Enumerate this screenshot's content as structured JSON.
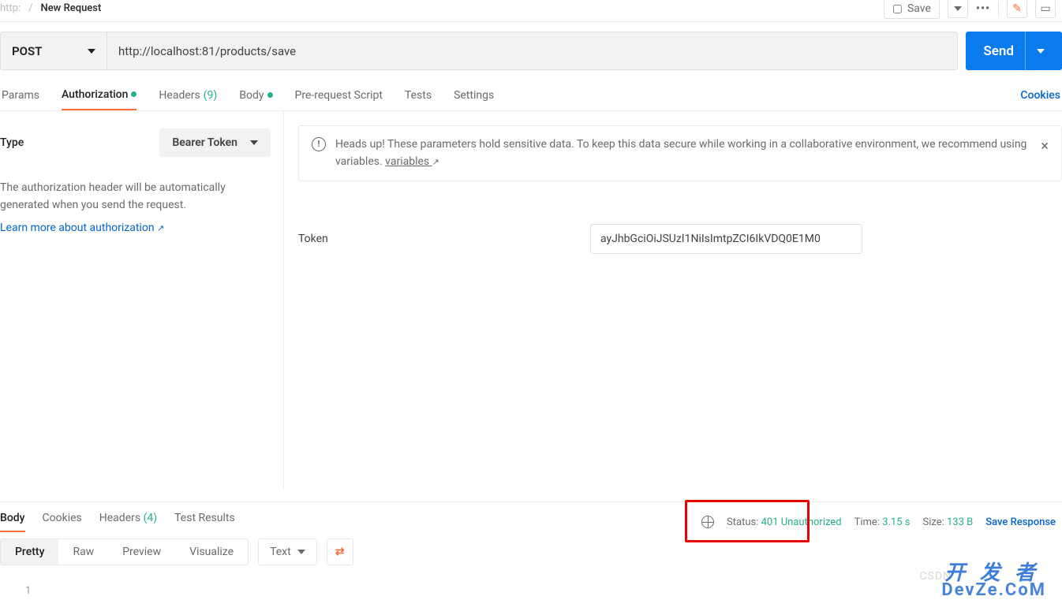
{
  "breadcrumb": {
    "http": "http:",
    "name": "New Request"
  },
  "topbar": {
    "save": "Save"
  },
  "request": {
    "method": "POST",
    "url": "http://localhost:81/products/save",
    "send": "Send"
  },
  "tabs": {
    "params": "Params",
    "auth": "Authorization",
    "headers": "Headers",
    "headers_count": "(9)",
    "body": "Body",
    "prerequest": "Pre-request Script",
    "tests": "Tests",
    "settings": "Settings",
    "cookies": "Cookies"
  },
  "auth": {
    "type_label": "Type",
    "type_value": "Bearer Token",
    "desc": "The authorization header will be automatically generated when you send the request.",
    "learn": "Learn more about authorization",
    "info_a": "Heads up! These parameters hold sensitive data. To keep this data secure while working in a collaborative environment, we recommend using variables.",
    "variables": "variables",
    "token_label": "Token",
    "token_value": "ayJhbGciOiJSUzI1NiIsImtpZCI6IkVDQ0E1M0"
  },
  "response": {
    "tabs": {
      "body": "Body",
      "cookies": "Cookies",
      "headers": "Headers",
      "headers_count": "(4)",
      "tests": "Test Results"
    },
    "status_label": "Status:",
    "status_value": "401 Unauthorized",
    "time_label": "Time:",
    "time_value": "3.15 s",
    "size_label": "Size:",
    "size_value": "133 B",
    "save": "Save Response",
    "view": {
      "pretty": "Pretty",
      "raw": "Raw",
      "preview": "Preview",
      "visualize": "Visualize",
      "format": "Text"
    },
    "line": "1"
  },
  "watermark": {
    "a": "开 发 者",
    "b": "DevZe.CoM",
    "c": "CSDN"
  }
}
